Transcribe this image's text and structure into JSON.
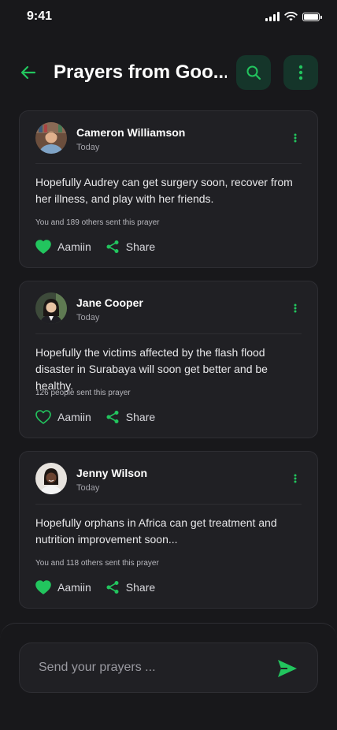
{
  "status_bar": {
    "time": "9:41"
  },
  "header": {
    "title": "Prayers from Goo..."
  },
  "colors": {
    "accent": "#22c55e",
    "background": "#18181b",
    "card": "#202024"
  },
  "posts": [
    {
      "author": "Cameron Williamson",
      "time": "Today",
      "text": "Hopefully Audrey can get surgery soon, recover from her illness, and play with her friends.",
      "sent_count": "You and 189 others sent this prayer",
      "aamiin_label": "Aamiin",
      "aamiin_active": true,
      "share_label": "Share"
    },
    {
      "author": "Jane Cooper",
      "time": "Today",
      "text": "Hopefully the victims affected by the flash flood disaster in Surabaya will soon get better and be healthy.",
      "sent_count": "126 people sent this prayer",
      "aamiin_label": "Aamiin",
      "aamiin_active": false,
      "share_label": "Share"
    },
    {
      "author": "Jenny Wilson",
      "time": "Today",
      "text": "Hopefully orphans in Africa can get treatment and nutrition improvement soon...",
      "sent_count": "You and 118 others sent this prayer",
      "aamiin_label": "Aamiin",
      "aamiin_active": true,
      "share_label": "Share"
    }
  ],
  "composer": {
    "placeholder": "Send your prayers ..."
  },
  "icons": [
    "back-arrow-icon",
    "search-icon",
    "more-vertical-icon",
    "heart-icon",
    "share-icon",
    "send-icon"
  ]
}
